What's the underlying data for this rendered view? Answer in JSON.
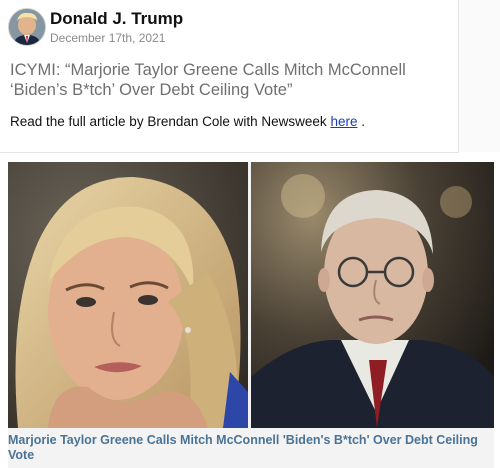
{
  "post": {
    "author": "Donald J. Trump",
    "date": "December 17th, 2021",
    "headline": "ICYMI: “Marjorie Taylor Greene Calls Mitch McConnell ‘Biden’s B*tch’ Over Debt Ceiling Vote”",
    "read_more_prefix": "Read the full article by Brendan Cole with Newsweek",
    "read_more_link": "here",
    "read_more_suffix": " ."
  },
  "link_preview": {
    "title": "Marjorie Taylor Greene Calls Mitch McConnell 'Biden's B*tch' Over Debt Ceiling Vote",
    "image_left": "woman-portrait-photo",
    "image_right": "man-portrait-photo"
  },
  "colors": {
    "author": "#111111",
    "date": "#8a8a8a",
    "headline": "#6f6f6f",
    "link": "#1a3db5",
    "preview_title": "#4a7396"
  }
}
